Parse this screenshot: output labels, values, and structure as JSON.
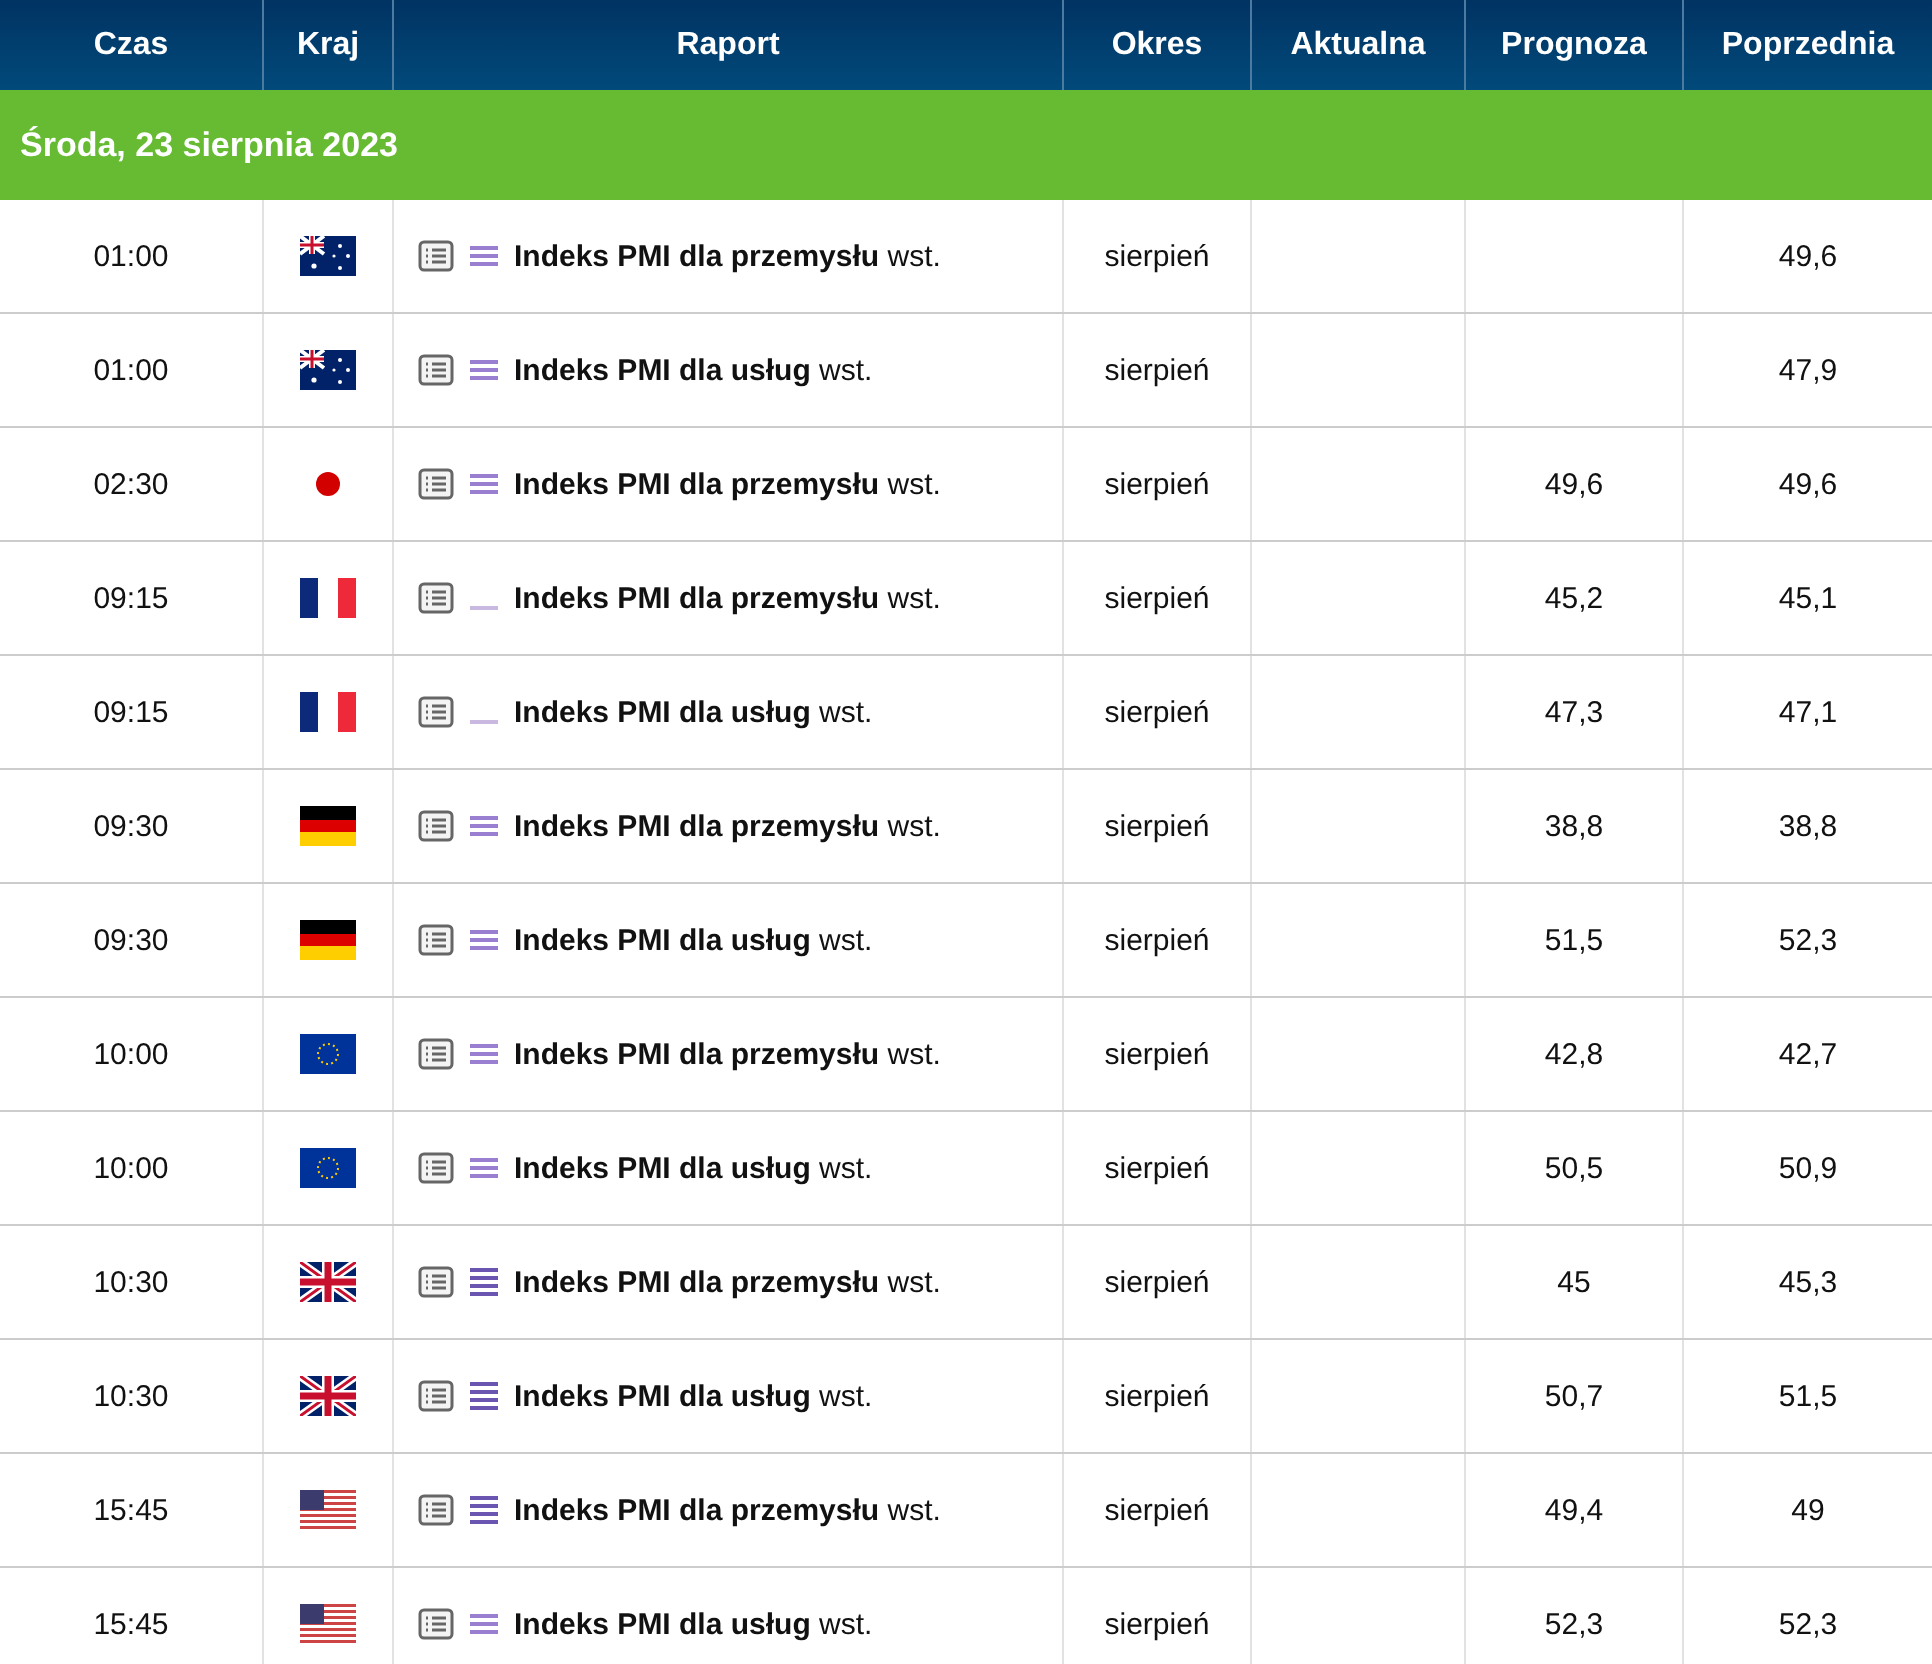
{
  "columns": [
    "Czas",
    "Kraj",
    "Raport",
    "Okres",
    "Aktualna",
    "Prognoza",
    "Poprzednia"
  ],
  "date_header": "Środa, 23 sierpnia 2023",
  "rows": [
    {
      "time": "01:00",
      "flag": {
        "kind": "au"
      },
      "importance": {
        "kind": "medium"
      },
      "report": "Indeks PMI dla przemysłu",
      "suffix": "wst.",
      "period": "sierpień",
      "forecast": "",
      "previous": "49,6"
    },
    {
      "time": "01:00",
      "flag": {
        "kind": "au"
      },
      "importance": {
        "kind": "medium"
      },
      "report": "Indeks PMI dla usług",
      "suffix": "wst.",
      "period": "sierpień",
      "forecast": "",
      "previous": "47,9"
    },
    {
      "time": "02:30",
      "flag": {
        "kind": "jp"
      },
      "importance": {
        "kind": "medium"
      },
      "report": "Indeks PMI dla przemysłu",
      "suffix": "wst.",
      "period": "sierpień",
      "forecast": "49,6",
      "previous": "49,6"
    },
    {
      "time": "09:15",
      "flag": {
        "kind": "fr"
      },
      "importance": {
        "kind": "low"
      },
      "report": "Indeks PMI dla przemysłu",
      "suffix": "wst.",
      "period": "sierpień",
      "forecast": "45,2",
      "previous": "45,1"
    },
    {
      "time": "09:15",
      "flag": {
        "kind": "fr"
      },
      "importance": {
        "kind": "low"
      },
      "report": "Indeks PMI dla usług",
      "suffix": "wst.",
      "period": "sierpień",
      "forecast": "47,3",
      "previous": "47,1"
    },
    {
      "time": "09:30",
      "flag": {
        "kind": "de"
      },
      "importance": {
        "kind": "medium"
      },
      "report": "Indeks PMI dla przemysłu",
      "suffix": "wst.",
      "period": "sierpień",
      "forecast": "38,8",
      "previous": "38,8"
    },
    {
      "time": "09:30",
      "flag": {
        "kind": "de"
      },
      "importance": {
        "kind": "medium"
      },
      "report": "Indeks PMI dla usług",
      "suffix": "wst.",
      "period": "sierpień",
      "forecast": "51,5",
      "previous": "52,3"
    },
    {
      "time": "10:00",
      "flag": {
        "kind": "eu"
      },
      "importance": {
        "kind": "medium"
      },
      "report": "Indeks PMI dla przemysłu",
      "suffix": "wst.",
      "period": "sierpień",
      "forecast": "42,8",
      "previous": "42,7"
    },
    {
      "time": "10:00",
      "flag": {
        "kind": "eu"
      },
      "importance": {
        "kind": "medium"
      },
      "report": "Indeks PMI dla usług",
      "suffix": "wst.",
      "period": "sierpień",
      "forecast": "50,5",
      "previous": "50,9"
    },
    {
      "time": "10:30",
      "flag": {
        "kind": "gb"
      },
      "importance": {
        "kind": "high"
      },
      "report": "Indeks PMI dla przemysłu",
      "suffix": "wst.",
      "period": "sierpień",
      "forecast": "45",
      "previous": "45,3"
    },
    {
      "time": "10:30",
      "flag": {
        "kind": "gb"
      },
      "importance": {
        "kind": "high"
      },
      "report": "Indeks PMI dla usług",
      "suffix": "wst.",
      "period": "sierpień",
      "forecast": "50,7",
      "previous": "51,5"
    },
    {
      "time": "15:45",
      "flag": {
        "kind": "us"
      },
      "importance": {
        "kind": "high"
      },
      "report": "Indeks PMI dla przemysłu",
      "suffix": "wst.",
      "period": "sierpień",
      "forecast": "49,4",
      "previous": "49"
    },
    {
      "time": "15:45",
      "flag": {
        "kind": "us"
      },
      "importance": {
        "kind": "medium"
      },
      "report": "Indeks PMI dla usług",
      "suffix": "wst.",
      "period": "sierpień",
      "forecast": "52,3",
      "previous": "52,3"
    }
  ]
}
